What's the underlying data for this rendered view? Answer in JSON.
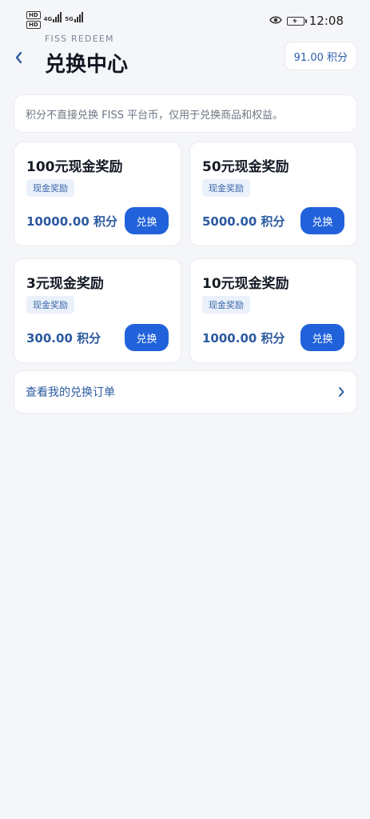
{
  "status_bar": {
    "hd_label": "HD",
    "net_4g": "4G",
    "net_5g": "5G",
    "time": "12:08"
  },
  "header": {
    "subtitle": "FISS REDEEM",
    "title": "兑换中心",
    "points": "91.00 积分"
  },
  "notice": {
    "text": "积分不直接兑换 FISS 平台币，仅用于兑换商品和权益。"
  },
  "products": [
    {
      "title": "100元现金奖励",
      "tag": "现金奖励",
      "price": "10000.00 积分",
      "button": "兑换"
    },
    {
      "title": "50元现金奖励",
      "tag": "现金奖励",
      "price": "5000.00 积分",
      "button": "兑换"
    },
    {
      "title": "3元现金奖励",
      "tag": "现金奖励",
      "price": "300.00 积分",
      "button": "兑换"
    },
    {
      "title": "10元现金奖励",
      "tag": "现金奖励",
      "price": "1000.00 积分",
      "button": "兑换"
    }
  ],
  "orders_link": {
    "label": "查看我的兑换订单"
  },
  "colors": {
    "accent": "#2162db",
    "link_text": "#2b5aa0",
    "background": "#f5f6f9"
  },
  "icons": {
    "back": "chevron-left-icon",
    "eye": "eye-icon",
    "battery": "battery-charging-icon",
    "orders_arrow": "chevron-right-icon"
  }
}
